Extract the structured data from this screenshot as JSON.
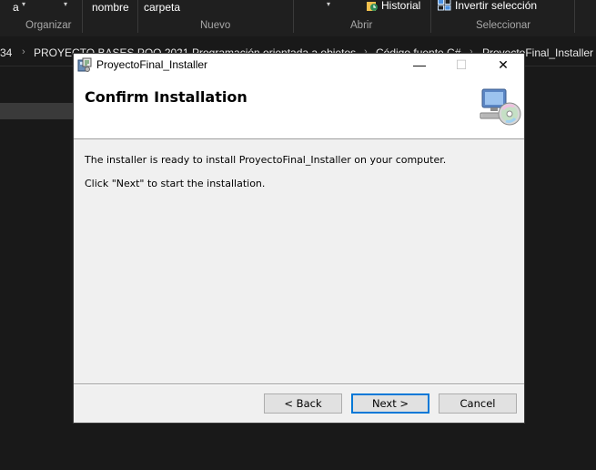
{
  "explorer": {
    "ribbon_items": [
      "a",
      "nombre",
      "carpeta",
      "Historial",
      "Invertir selección"
    ],
    "group_labels": [
      "Organizar",
      "Nuevo",
      "Abrir",
      "Seleccionar"
    ],
    "breadcrumbs": [
      "34",
      "PROYECTO BASES POO 2021",
      "Programación orientada a objetos",
      "Código fuente C#",
      "ProyectoFinal_Installer"
    ]
  },
  "dialog": {
    "title": "ProyectoFinal_Installer",
    "heading": "Confirm Installation",
    "message": "The installer is ready to install ProyectoFinal_Installer on your computer.",
    "instruction": "Click \"Next\" to start the installation.",
    "back_label": "< Back",
    "next_label": "Next >",
    "cancel_label": "Cancel",
    "minimize_glyph": "—",
    "maximize_glyph": "☐",
    "close_glyph": "✕",
    "icons": {
      "app": "installer-app-icon",
      "banner": "computer-cd-icon"
    }
  }
}
